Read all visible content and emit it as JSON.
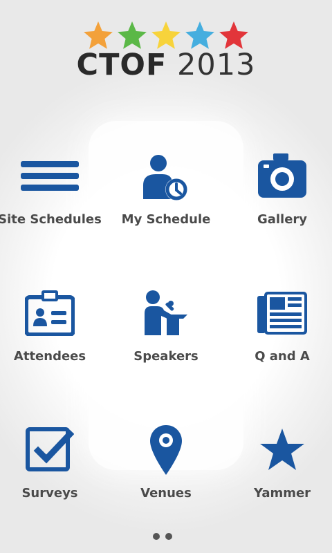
{
  "header": {
    "logo_title_bold": "CTOF",
    "logo_title_year": "2013",
    "logo_star_colors": [
      "#f3a13a",
      "#5bb847",
      "#f7d33b",
      "#45aedf",
      "#e2353a"
    ]
  },
  "colors": {
    "icon_blue": "#1a56a0",
    "label_gray": "#4a4a4a"
  },
  "grid": {
    "items": [
      {
        "label": "Site Schedules",
        "icon": "list-icon"
      },
      {
        "label": "My Schedule",
        "icon": "person-clock-icon"
      },
      {
        "label": "Gallery",
        "icon": "camera-icon"
      },
      {
        "label": "Attendees",
        "icon": "id-badge-icon"
      },
      {
        "label": "Speakers",
        "icon": "speaker-podium-icon"
      },
      {
        "label": "Q and A",
        "icon": "newspaper-icon"
      },
      {
        "label": "Surveys",
        "icon": "checkbox-icon"
      },
      {
        "label": "Venues",
        "icon": "map-pin-icon"
      },
      {
        "label": "Yammer",
        "icon": "star-icon"
      }
    ]
  },
  "pager": {
    "pages": 2
  }
}
